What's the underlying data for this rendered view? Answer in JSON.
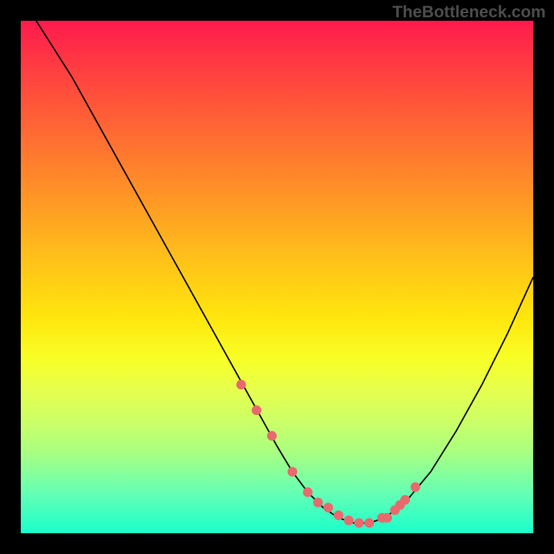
{
  "watermark": "TheBottleneck.com",
  "chart_data": {
    "type": "line",
    "title": "",
    "xlabel": "",
    "ylabel": "",
    "xlim": [
      0,
      100
    ],
    "ylim": [
      0,
      100
    ],
    "series": [
      {
        "name": "curve",
        "x": [
          3,
          10,
          15,
          20,
          25,
          30,
          35,
          40,
          45,
          50,
          53,
          56,
          59,
          62,
          65,
          68,
          71,
          75,
          80,
          85,
          90,
          95,
          100
        ],
        "y": [
          100,
          89,
          80,
          71,
          62,
          53,
          44,
          35,
          26,
          17,
          12,
          8,
          5,
          3,
          2,
          2,
          3,
          6,
          12,
          20,
          29,
          39,
          50
        ]
      }
    ],
    "markers": {
      "name": "dots",
      "color": "#e8696e",
      "x": [
        43,
        46,
        49,
        53,
        56,
        58,
        60,
        62,
        64,
        66,
        68,
        70.5,
        71.5,
        73,
        74,
        75,
        77
      ],
      "y": [
        29,
        24,
        19,
        12,
        8,
        6,
        5,
        3.5,
        2.5,
        2,
        2,
        3,
        3,
        4.5,
        5.5,
        6.5,
        9
      ]
    }
  }
}
